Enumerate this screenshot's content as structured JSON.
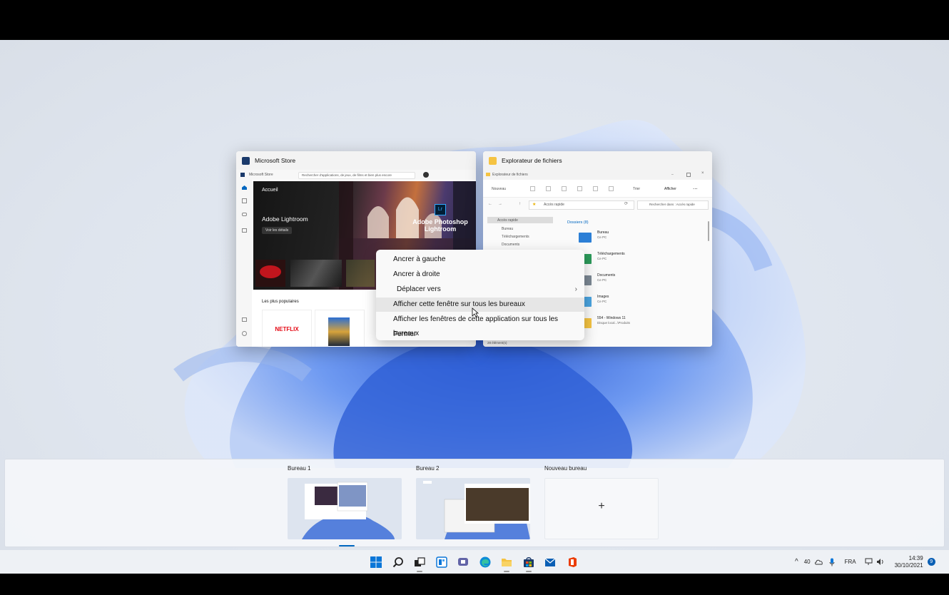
{
  "windows": {
    "store": {
      "title": "Microsoft Store",
      "inner_title": "Microsoft Store",
      "search_placeholder": "Rechercher d'applications, de jeux, de films et bien plus encore",
      "nav_home": "Accueil",
      "hero_title": "Adobe Lightroom",
      "hero_link": "Voir les détails",
      "hero_badge": "Adobe Photoshop Lightroom",
      "hero_badge_icon": "Lr",
      "section_title": "Les plus populaires",
      "netflix": "NETFLIX",
      "sidebar": [
        "Accueil",
        "Applications",
        "Jeux",
        "Films et TV",
        "Bibliothèque",
        "Aide"
      ]
    },
    "explorer": {
      "title": "Explorateur de fichiers",
      "inner_title": "Explorateur de fichiers",
      "toolbar_new": "Nouveau",
      "toolbar_sort": "Trier",
      "toolbar_view": "Afficher",
      "toolbar_more": "...",
      "address": "Accès rapide",
      "search_placeholder": "Rechercher dans : Accès rapide",
      "nav": [
        "Accès rapide",
        "Bureau",
        "Téléchargements",
        "Documents"
      ],
      "section": "Dossiers (8)",
      "folders": [
        {
          "name": "Bureau",
          "sub": "Ce PC"
        },
        {
          "name": "Téléchargements",
          "sub": "Ce PC"
        },
        {
          "name": "Documents",
          "sub": "Ce PC"
        },
        {
          "name": "Images",
          "sub": "Ce PC"
        },
        {
          "name": "554 - Windows 11",
          "sub": "Disque local...\\Produits"
        }
      ],
      "status": "28 élément(s)"
    }
  },
  "context_menu": {
    "items": [
      {
        "label": "Ancrer à gauche"
      },
      {
        "label": "Ancrer à droite"
      },
      {
        "label": "Déplacer vers",
        "submenu_arrow": "›"
      },
      {
        "label": "Afficher cette fenêtre sur tous les bureaux"
      },
      {
        "label": "Afficher les fenêtres de cette application sur tous les bureaux"
      },
      {
        "label": "Fermer"
      }
    ],
    "highlighted_index": 3
  },
  "desktops": [
    {
      "label": "Bureau 1",
      "active": true
    },
    {
      "label": "Bureau 2",
      "active": false
    },
    {
      "label": "Nouveau bureau",
      "plus": "+"
    }
  ],
  "taskbar": {
    "icons": [
      "windows-start-icon",
      "search-icon",
      "task-view-icon",
      "widgets-icon",
      "teams-chat-icon",
      "edge-icon",
      "file-explorer-icon",
      "microsoft-store-icon",
      "mail-icon",
      "office-icon"
    ],
    "tray": {
      "temperature": "40",
      "language": "FRA",
      "time": "14:39",
      "date": "30/10/2021",
      "notification_count": "9"
    }
  },
  "colors": {
    "accent": "#0067c0",
    "wallpaper_blue": "#3d6fd8",
    "netflix_red": "#e50914"
  }
}
